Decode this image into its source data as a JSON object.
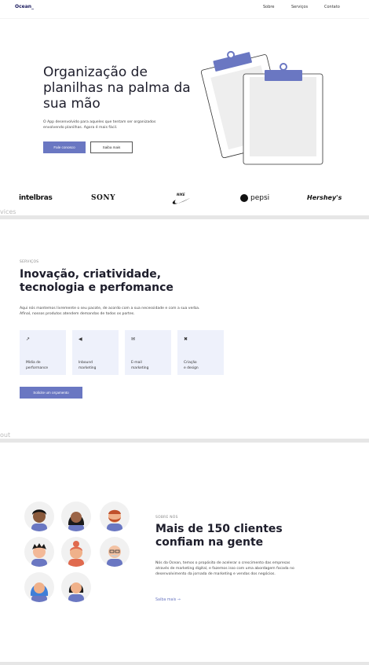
{
  "nav": {
    "logo": "Ocean_",
    "links": [
      "Sobre",
      "Serviços",
      "Contato"
    ]
  },
  "hero": {
    "title": "Organização de planilhas na palma da sua mão",
    "text": "O App desenvolvido para aqueles que tentam ser organizados envolvendo planilhas. Agora é mais fácil.",
    "primary_button": "Fale conosco",
    "secondary_button": "Saiba mais"
  },
  "brands": [
    "intelbras",
    "SONY",
    "NIKE",
    "pepsi",
    "Hershey's"
  ],
  "stray_labels": {
    "services": "vices",
    "about": "out"
  },
  "services": {
    "eyebrow": "SERVIÇOS",
    "title": "Inovação, criatividade, tecnologia e perfomance",
    "text": "Aqui nós mantemos livremente o seu pacote, de acordo com a sua necessidade e com a sua verba. Afinal, nossos produtos atendem demandas de todos os portes.",
    "cards": [
      {
        "icon": "chart-icon",
        "glyph": "↗",
        "label": "Mídia de\nperformance"
      },
      {
        "icon": "megaphone-icon",
        "glyph": "◀",
        "label": "Inbound\nmarketing"
      },
      {
        "icon": "mail-icon",
        "glyph": "✉",
        "label": "E-mail\nmarketing"
      },
      {
        "icon": "design-icon",
        "glyph": "✖",
        "label": "Criação\ne design"
      }
    ],
    "button": "Solicite um orçamento"
  },
  "about": {
    "eyebrow": "SOBRE NÓS",
    "title": "Mais de 150 clientes confiam na gente",
    "text": "Nós da Ocean, temos o propósito de acelerar o crescimento das empresas através de marketing digital, e fazemos isso com uma abordagem focada no desenvolvimento da jornada de marketing e vendas dos negócios.",
    "link": "Saiba mais →"
  },
  "colors": {
    "accent": "#6a77c2",
    "card_bg": "#eef1fb",
    "divider": "#e6e6e6"
  }
}
